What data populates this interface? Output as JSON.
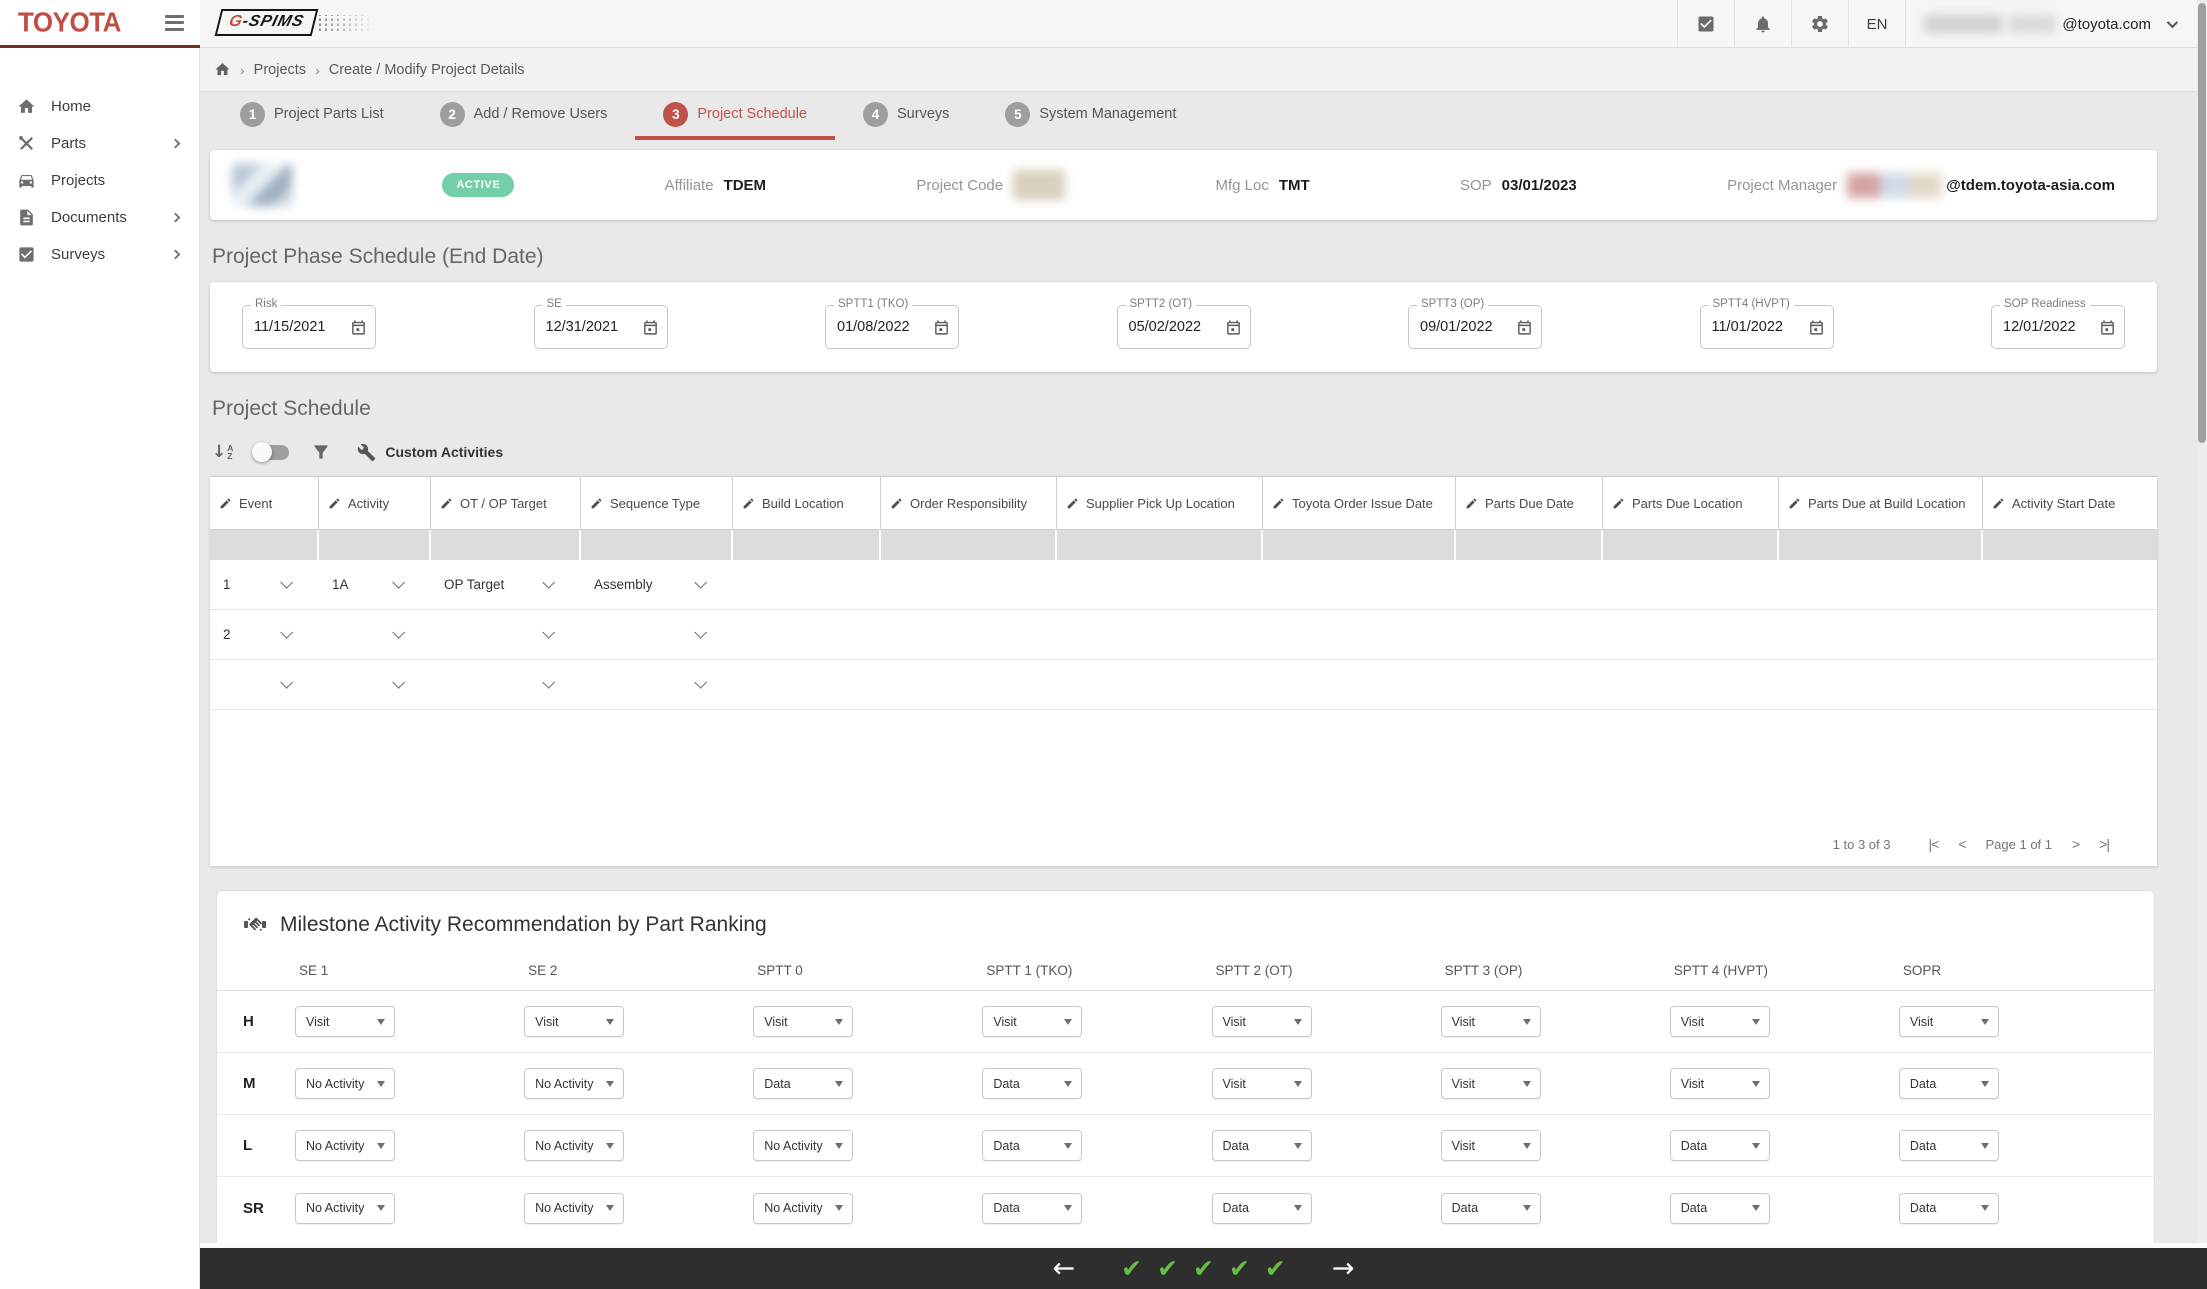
{
  "header": {
    "brand": "TOYOTA",
    "app_name_prefix": "G",
    "app_name_suffix": "-SPIMS",
    "language": "EN",
    "user_email": "@toyota.com"
  },
  "sidebar": {
    "items": [
      {
        "label": "Home"
      },
      {
        "label": "Parts"
      },
      {
        "label": "Projects"
      },
      {
        "label": "Documents"
      },
      {
        "label": "Surveys"
      }
    ]
  },
  "breadcrumb": {
    "items": [
      "Projects",
      "Create / Modify Project Details"
    ],
    "separator": "›"
  },
  "stepper": {
    "steps": [
      {
        "num": "1",
        "label": "Project Parts List"
      },
      {
        "num": "2",
        "label": "Add / Remove Users"
      },
      {
        "num": "3",
        "label": "Project Schedule"
      },
      {
        "num": "4",
        "label": "Surveys"
      },
      {
        "num": "5",
        "label": "System Management"
      }
    ]
  },
  "project_info": {
    "status": "ACTIVE",
    "affiliate_label": "Affiliate",
    "affiliate": "TDEM",
    "project_code_label": "Project Code",
    "mfg_loc_label": "Mfg Loc",
    "mfg_loc": "TMT",
    "sop_label": "SOP",
    "sop": "03/01/2023",
    "pm_label": "Project Manager",
    "pm_email": "@tdem.toyota-asia.com"
  },
  "phase_schedule": {
    "title": "Project Phase Schedule (End Date)",
    "fields": [
      {
        "label": "Risk",
        "value": "11/15/2021"
      },
      {
        "label": "SE",
        "value": "12/31/2021"
      },
      {
        "label": "SPTT1 (TKO)",
        "value": "01/08/2022"
      },
      {
        "label": "SPTT2 (OT)",
        "value": "05/02/2022"
      },
      {
        "label": "SPTT3 (OP)",
        "value": "09/01/2022"
      },
      {
        "label": "SPTT4 (HVPT)",
        "value": "11/01/2022"
      },
      {
        "label": "SOP Readiness",
        "value": "12/01/2022"
      }
    ]
  },
  "schedule": {
    "title": "Project Schedule",
    "custom_activities_label": "Custom Activities",
    "columns": [
      "Event",
      "Activity",
      "OT / OP Target",
      "Sequence Type",
      "Build Location",
      "Order Responsibility",
      "Supplier Pick Up Location",
      "Toyota Order Issue Date",
      "Parts Due Date",
      "Parts Due Location",
      "Parts Due at Build Location",
      "Activity Start Date"
    ],
    "rows": [
      {
        "event": "1",
        "activity": "1A",
        "ot_op_target": "OP Target",
        "sequence_type": "Assembly"
      },
      {
        "event": "2",
        "activity": "",
        "ot_op_target": "",
        "sequence_type": ""
      },
      {
        "event": "",
        "activity": "",
        "ot_op_target": "",
        "sequence_type": ""
      }
    ],
    "pagination": {
      "range": "1 to 3 of 3",
      "first": "|<",
      "prev": "<",
      "page": "Page 1 of 1",
      "next": ">",
      "last": ">|"
    }
  },
  "milestone": {
    "title": "Milestone Activity Recommendation by Part Ranking",
    "columns": [
      "SE 1",
      "SE 2",
      "SPTT 0",
      "SPTT 1 (TKO)",
      "SPTT 2 (OT)",
      "SPTT 3 (OP)",
      "SPTT 4 (HVPT)",
      "SOPR"
    ],
    "rows": [
      {
        "rank": "H",
        "values": [
          "Visit",
          "Visit",
          "Visit",
          "Visit",
          "Visit",
          "Visit",
          "Visit",
          "Visit"
        ]
      },
      {
        "rank": "M",
        "values": [
          "No Activity",
          "No Activity",
          "Data",
          "Data",
          "Visit",
          "Visit",
          "Visit",
          "Data"
        ]
      },
      {
        "rank": "L",
        "values": [
          "No Activity",
          "No Activity",
          "No Activity",
          "Data",
          "Data",
          "Visit",
          "Data",
          "Data"
        ]
      },
      {
        "rank": "SR",
        "values": [
          "No Activity",
          "No Activity",
          "No Activity",
          "Data",
          "Data",
          "Data",
          "Data",
          "Data"
        ]
      }
    ]
  },
  "footer": {
    "back_arrow": "←",
    "forward_arrow": "→",
    "check": "✔"
  },
  "colors": {
    "brand_red": "#bf4f44",
    "active_badge": "#72cfa7",
    "footer_bg": "#2e2e2e",
    "check_green": "#68bd44",
    "step_active": "#c05349"
  }
}
